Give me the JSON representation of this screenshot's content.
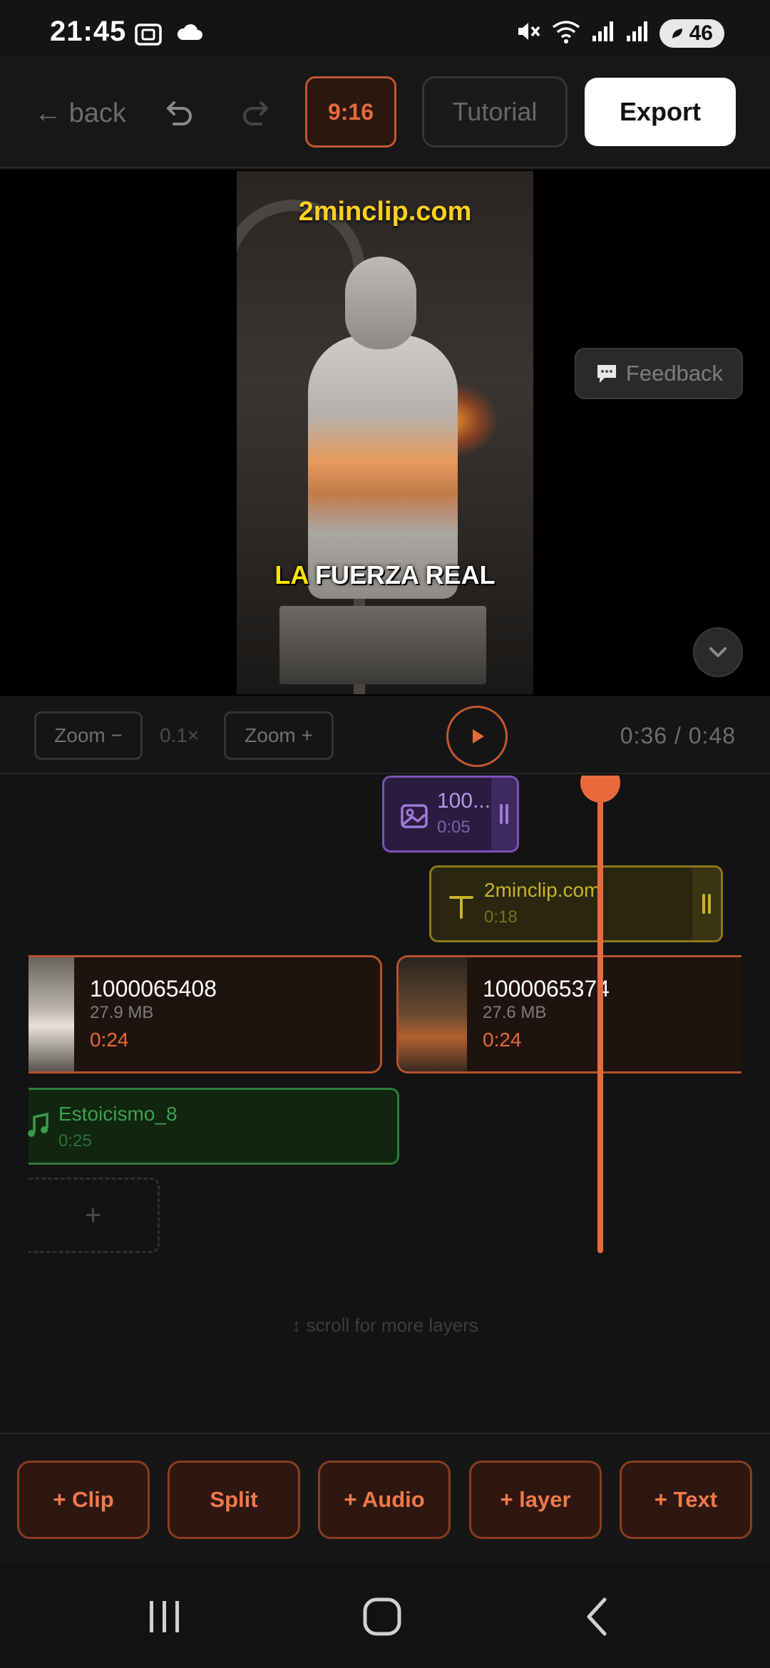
{
  "status_bar": {
    "time": "21:45",
    "battery": "46",
    "icons": [
      "screenshot-icon",
      "cloud-icon",
      "mute-icon",
      "wifi-icon",
      "signal-icon",
      "signal-icon",
      "battery-icon"
    ]
  },
  "toolbar": {
    "back_label": "back",
    "aspect_ratio": "9:16",
    "tutorial_label": "Tutorial",
    "export_label": "Export"
  },
  "preview": {
    "overlay_text": "2minclip.com",
    "caption_highlight": "LA",
    "caption_rest": "FUERZA REAL",
    "feedback_label": "Feedback"
  },
  "controls": {
    "zoom_out_label": "Zoom −",
    "zoom_level": "0.1×",
    "zoom_in_label": "Zoom +",
    "time_readout": "0:36 / 0:48"
  },
  "timeline": {
    "image_layer": {
      "name": "100...",
      "duration": "0:05"
    },
    "text_layer": {
      "name": "2minclip.com",
      "duration": "0:18"
    },
    "video_clips": [
      {
        "name": "1000065408",
        "size": "27.9 MB",
        "duration": "0:24"
      },
      {
        "name": "1000065374",
        "size": "27.6 MB",
        "duration": "0:24"
      }
    ],
    "audio_clip": {
      "name": "Estoicismo_8",
      "duration": "0:25"
    },
    "add_track_label": "+",
    "scroll_hint": "↕ scroll for more layers",
    "playhead_position": 0.75
  },
  "actions": {
    "clip": "+ Clip",
    "split": "Split",
    "audio": "+ Audio",
    "layer": "+ layer",
    "text": "+ Text"
  },
  "colors": {
    "accent": "#e86a3c",
    "image_layer": "#7b52b8",
    "text_layer": "#c8b428",
    "audio_layer": "#3a9a4a"
  }
}
